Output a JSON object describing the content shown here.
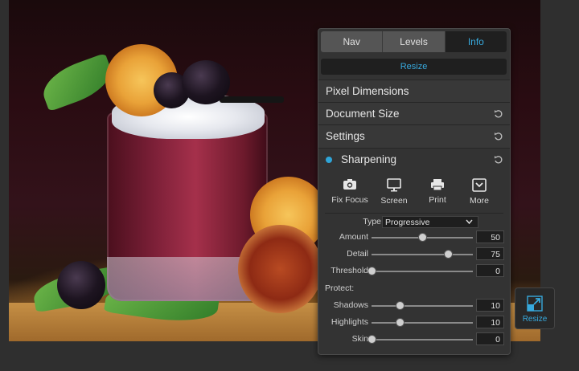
{
  "tabs": [
    {
      "label": "Nav",
      "active": false
    },
    {
      "label": "Levels",
      "active": false
    },
    {
      "label": "Info",
      "active": true
    }
  ],
  "resize_button": "Resize",
  "sections": {
    "pixel_dimensions": "Pixel Dimensions",
    "document_size": "Document Size",
    "settings": "Settings",
    "sharpening": "Sharpening"
  },
  "tools": [
    {
      "label": "Fix Focus",
      "icon": "camera-icon"
    },
    {
      "label": "Screen",
      "icon": "monitor-icon"
    },
    {
      "label": "Print",
      "icon": "printer-icon"
    },
    {
      "label": "More",
      "icon": "more-chevron-icon"
    }
  ],
  "type": {
    "label": "Type",
    "value": "Progressive"
  },
  "sliders": {
    "amount": {
      "label": "Amount",
      "value": "50",
      "level": 0.5
    },
    "detail": {
      "label": "Detail",
      "value": "75",
      "level": 0.75
    },
    "threshold": {
      "label": "Threshold",
      "value": "0",
      "level": 0
    }
  },
  "protect": {
    "label": "Protect:",
    "shadows": {
      "label": "Shadows",
      "value": "10",
      "level": 0.28
    },
    "highlights": {
      "label": "Highlights",
      "value": "10",
      "level": 0.28
    },
    "skin": {
      "label": "Skin",
      "value": "0",
      "level": 0
    }
  },
  "float_resize": {
    "label": "Resize",
    "icon": "resize-arrow-icon"
  },
  "colors": {
    "accent": "#37a9dd",
    "panel": "#333333",
    "background": "#2f2f2f"
  }
}
